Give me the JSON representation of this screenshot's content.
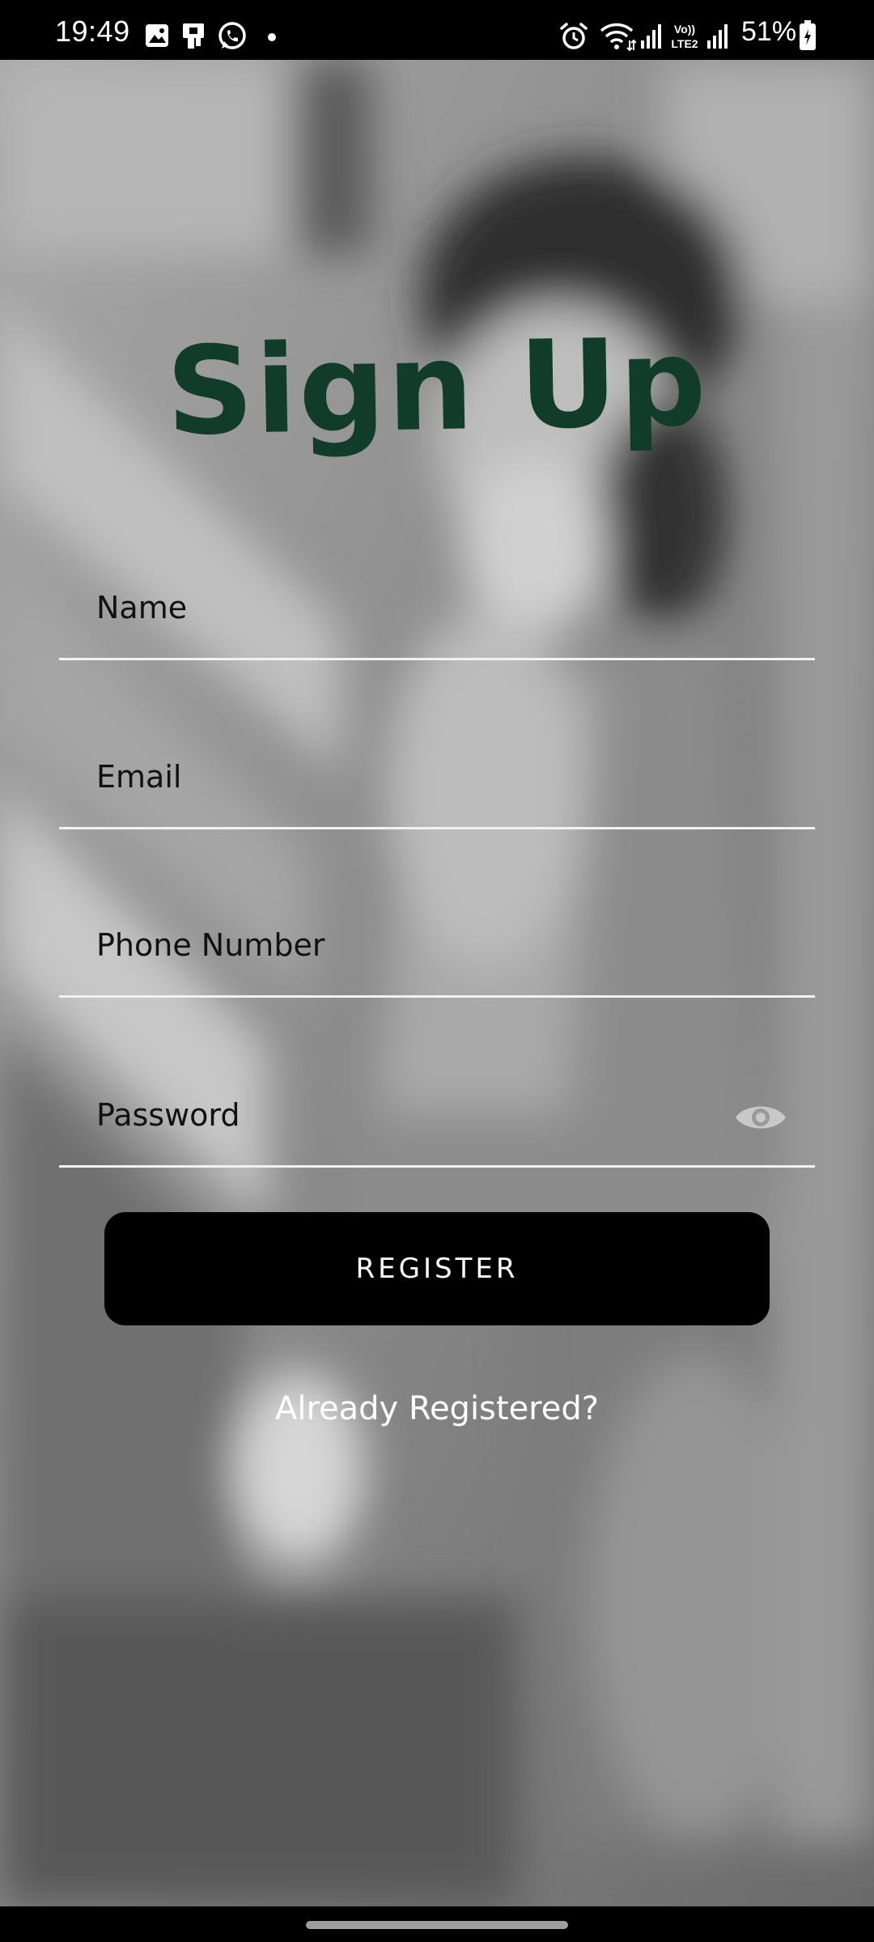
{
  "status_bar": {
    "time": "19:49",
    "battery_percent": "51%",
    "notification_icons": [
      "gallery-icon",
      "sim-icon",
      "whatsapp-icon",
      "dot-icon"
    ],
    "system_icons": [
      "alarm-icon",
      "wifi-icon",
      "signal-icon",
      "volte-icon",
      "signal-icon",
      "battery-icon"
    ],
    "volte_label": "Vo)) LTE2"
  },
  "form": {
    "title": "Sign Up",
    "fields": [
      {
        "label": "Name"
      },
      {
        "label": "Email"
      },
      {
        "label": "Phone Number"
      },
      {
        "label": "Password"
      }
    ],
    "register_label": "REGISTER",
    "already_registered": "Already Registered?"
  },
  "colors": {
    "title": "#123c2a",
    "button_bg": "#000000",
    "underline": "#f2f2f2"
  }
}
